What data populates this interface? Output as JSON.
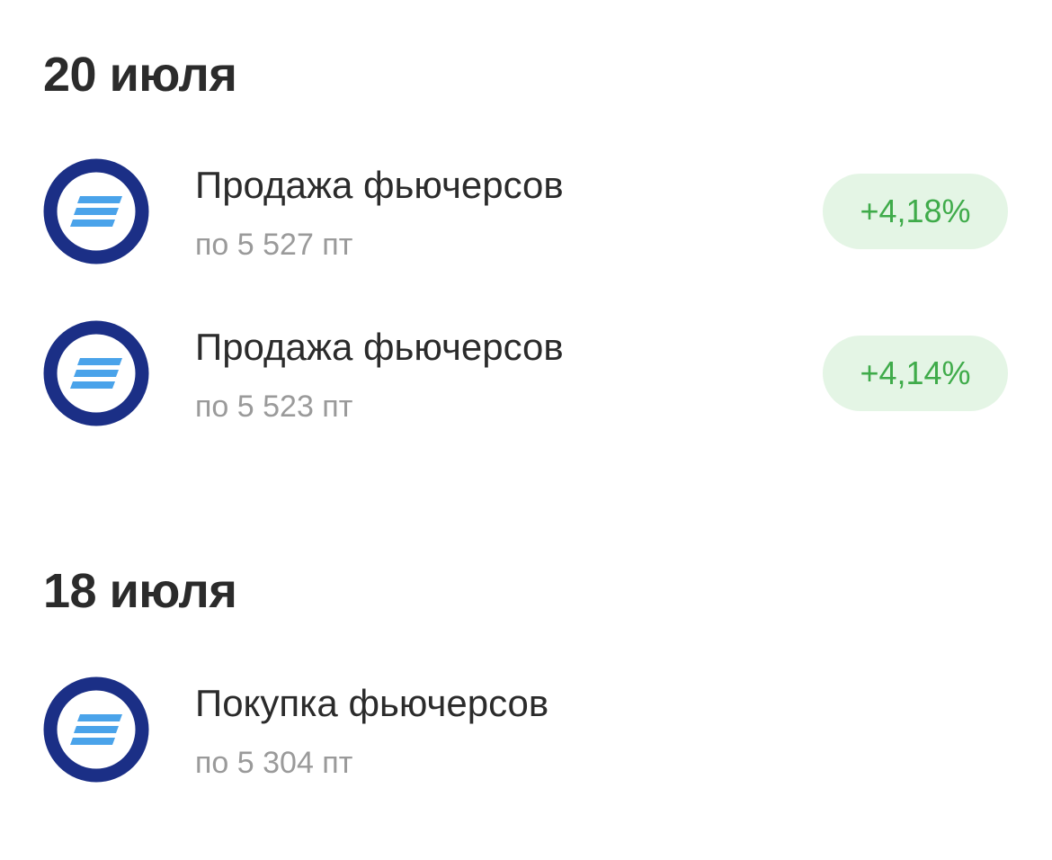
{
  "sections": [
    {
      "date": "20 июля",
      "operations": [
        {
          "title": "Продажа фьючерсов",
          "subtitle": "по 5 527 пт",
          "change": "+4,18%"
        },
        {
          "title": "Продажа фьючерсов",
          "subtitle": "по 5 523 пт",
          "change": "+4,14%"
        }
      ]
    },
    {
      "date": "18 июля",
      "operations": [
        {
          "title": "Покупка фьючерсов",
          "subtitle": "по 5 304 пт"
        }
      ]
    }
  ],
  "colors": {
    "logo_ring": "#1b2f86",
    "logo_stripes": "#4aa3ea",
    "change_text": "#3fab4a",
    "change_bg": "#e4f5e5"
  },
  "icons": {
    "operation_logo": "futures-logo-icon"
  }
}
